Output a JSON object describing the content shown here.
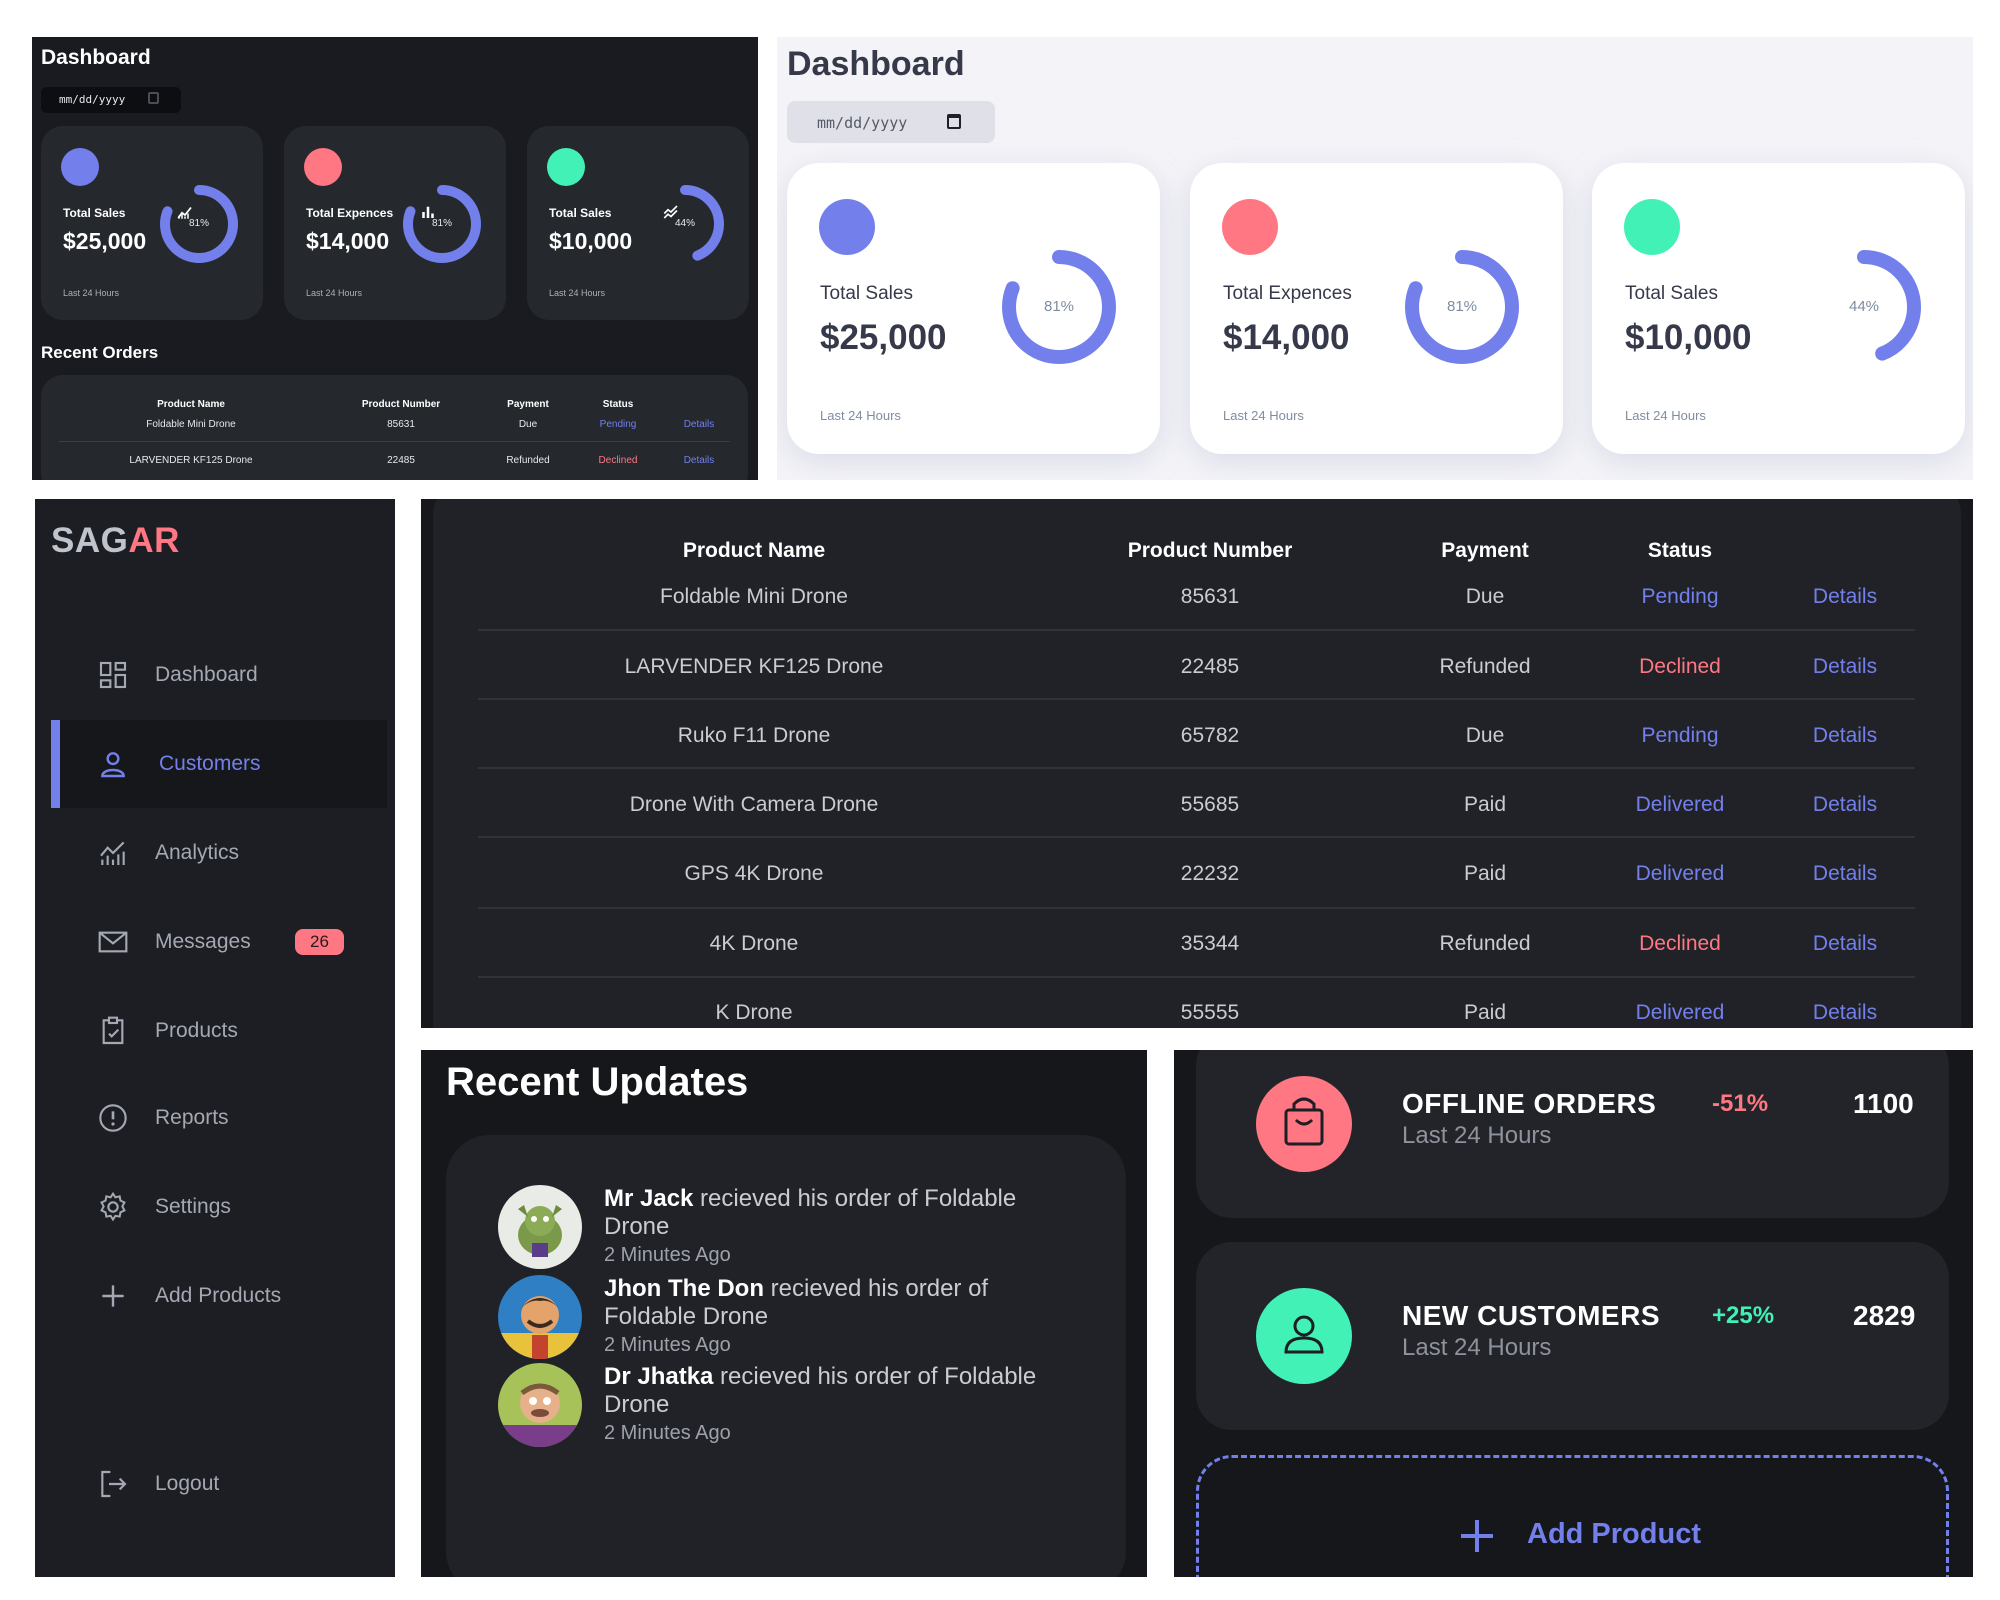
{
  "colors": {
    "primary": "#7380ec",
    "danger": "#ff7782",
    "success": "#41f1b6",
    "dark_bg": "#1c1e23",
    "light_bg": "#f4f4f8"
  },
  "dashboard": {
    "title": "Dashboard",
    "date_placeholder": "mm/dd/yyyy",
    "cards": [
      {
        "icon": "analytics-icon",
        "color": "#7380ec",
        "label": "Total Sales",
        "value": "$25,000",
        "percent": 81,
        "percent_label": "81%",
        "period": "Last 24 Hours"
      },
      {
        "icon": "bar-chart-icon",
        "color": "#ff7782",
        "label": "Total Expences",
        "value": "$14,000",
        "percent": 81,
        "percent_label": "81%",
        "period": "Last 24 Hours"
      },
      {
        "icon": "stocks-icon",
        "color": "#41f1b6",
        "label": "Total Sales",
        "value": "$10,000",
        "percent": 44,
        "percent_label": "44%",
        "period": "Last 24 Hours"
      }
    ],
    "recent_orders_title": "Recent Orders"
  },
  "orders": {
    "columns": [
      "Product Name",
      "Product Number",
      "Payment",
      "Status"
    ],
    "rows": [
      {
        "name": "Foldable Mini Drone",
        "number": "85631",
        "payment": "Due",
        "status": "Pending",
        "link": "Details"
      },
      {
        "name": "LARVENDER KF125 Drone",
        "number": "22485",
        "payment": "Refunded",
        "status": "Declined",
        "link": "Details"
      },
      {
        "name": "Ruko F11 Drone",
        "number": "65782",
        "payment": "Due",
        "status": "Pending",
        "link": "Details"
      },
      {
        "name": "Drone With Camera Drone",
        "number": "55685",
        "payment": "Paid",
        "status": "Delivered",
        "link": "Details"
      },
      {
        "name": "GPS 4K Drone",
        "number": "22232",
        "payment": "Paid",
        "status": "Delivered",
        "link": "Details"
      },
      {
        "name": "4K Drone",
        "number": "35344",
        "payment": "Refunded",
        "status": "Declined",
        "link": "Details"
      },
      {
        "name": "K Drone",
        "number": "55555",
        "payment": "Paid",
        "status": "Delivered",
        "link": "Details"
      }
    ]
  },
  "sidebar": {
    "logo_main": "SAG",
    "logo_accent": "AR",
    "items": [
      {
        "label": "Dashboard",
        "icon": "grid-icon"
      },
      {
        "label": "Customers",
        "icon": "person-icon",
        "active": true
      },
      {
        "label": "Analytics",
        "icon": "insights-icon"
      },
      {
        "label": "Messages",
        "icon": "mail-icon",
        "badge": "26"
      },
      {
        "label": "Products",
        "icon": "inventory-icon"
      },
      {
        "label": "Reports",
        "icon": "report-icon"
      },
      {
        "label": "Settings",
        "icon": "settings-icon"
      },
      {
        "label": "Add Products",
        "icon": "add-icon"
      }
    ],
    "logout": "Logout"
  },
  "updates": {
    "title": "Recent Updates",
    "items": [
      {
        "name": "Mr Jack",
        "text": " recieved his order of Foldable Drone",
        "time": "2 Minutes Ago"
      },
      {
        "name": "Jhon The Don",
        "text": " recieved his order of Foldable Drone",
        "time": "2 Minutes Ago"
      },
      {
        "name": "Dr Jhatka",
        "text": " recieved his order of Foldable Drone",
        "time": "2 Minutes Ago"
      }
    ]
  },
  "analytics": {
    "items": [
      {
        "icon": "shopping-bag-icon",
        "color": "#ff7782",
        "title": "OFFLINE ORDERS",
        "sub": "Last 24 Hours",
        "change": "-51%",
        "change_color": "#ff7782",
        "count": "1100"
      },
      {
        "icon": "person-icon",
        "color": "#41f1b6",
        "title": "NEW CUSTOMERS",
        "sub": "Last 24 Hours",
        "change": "+25%",
        "change_color": "#41f1b6",
        "count": "2829"
      }
    ],
    "add_label": "Add Product"
  }
}
